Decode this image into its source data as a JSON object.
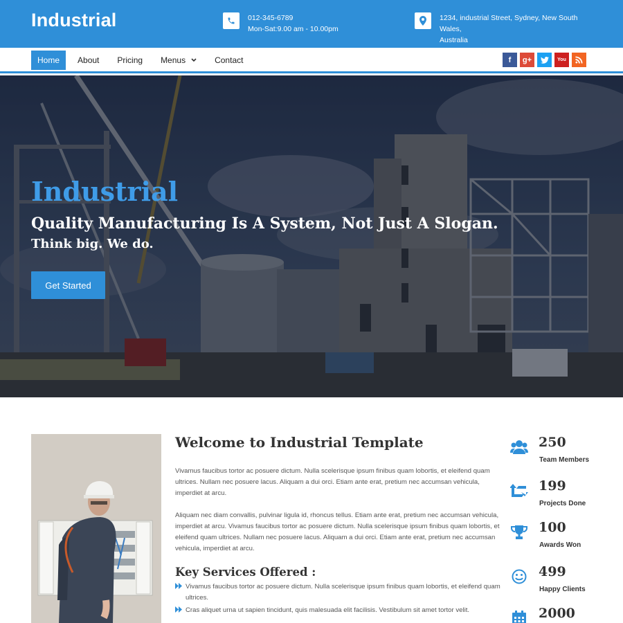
{
  "header": {
    "brand": "Industrial",
    "phone": "012-345-6789",
    "hours": "Mon-Sat:9.00 am - 10.00pm",
    "address_line1": "1234, industrial Street, Sydney, New South Wales,",
    "address_line2": "Australia"
  },
  "nav": {
    "items": [
      "Home",
      "About",
      "Pricing",
      "Menus",
      "Contact"
    ],
    "active": "Home",
    "dropdown_caret": "⌄"
  },
  "social": [
    {
      "name": "facebook",
      "glyph": "f",
      "color": "#3b5998"
    },
    {
      "name": "google-plus",
      "glyph": "g+",
      "color": "#dd4b39"
    },
    {
      "name": "twitter",
      "glyph": "t",
      "color": "#1da1f2"
    },
    {
      "name": "youtube",
      "glyph": "You",
      "color": "#cd201f"
    },
    {
      "name": "rss",
      "glyph": "rss",
      "color": "#f26522"
    }
  ],
  "hero": {
    "title": "Industrial",
    "subtitle": "Quality Manufacturing Is A System, Not Just A Slogan.",
    "tagline": "Think big. We do.",
    "button": "Get Started"
  },
  "welcome": {
    "title": "Welcome to Industrial Template",
    "para1": "Vivamus faucibus tortor ac posuere dictum. Nulla scelerisque ipsum finibus quam lobortis, et eleifend quam ultrices. Nullam nec posuere lacus. Aliquam a dui orci. Etiam ante erat, pretium nec accumsan vehicula, imperdiet at arcu.",
    "para2": "Aliquam nec diam convallis, pulvinar ligula id, rhoncus tellus. Etiam ante erat, pretium nec accumsan vehicula, imperdiet at arcu. Vivamus faucibus tortor ac posuere dictum. Nulla scelerisque ipsum finibus quam lobortis, et eleifend quam ultrices. Nullam nec posuere lacus. Aliquam a dui orci. Etiam ante erat, pretium nec accumsan vehicula, imperdiet at arcu.",
    "services_title": "Key Services Offered :",
    "services": [
      "Vivamus faucibus tortor ac posuere dictum. Nulla scelerisque ipsum finibus quam lobortis, et eleifend quam ultrices.",
      "Cras aliquet urna ut sapien tincidunt, quis malesuada elit facilisis. Vestibulum sit amet tortor velit."
    ]
  },
  "stats": [
    {
      "value": "250",
      "label": "Team Members",
      "icon": "users-icon"
    },
    {
      "value": "199",
      "label": "Projects Done",
      "icon": "retweet-icon"
    },
    {
      "value": "100",
      "label": "Awards Won",
      "icon": "trophy-icon"
    },
    {
      "value": "499",
      "label": "Happy Clients",
      "icon": "smile-icon"
    },
    {
      "value": "2000",
      "label": "",
      "icon": "calendar-icon"
    }
  ],
  "colors": {
    "primary": "#2f8fd8",
    "hero_title": "#3f9ce8"
  }
}
